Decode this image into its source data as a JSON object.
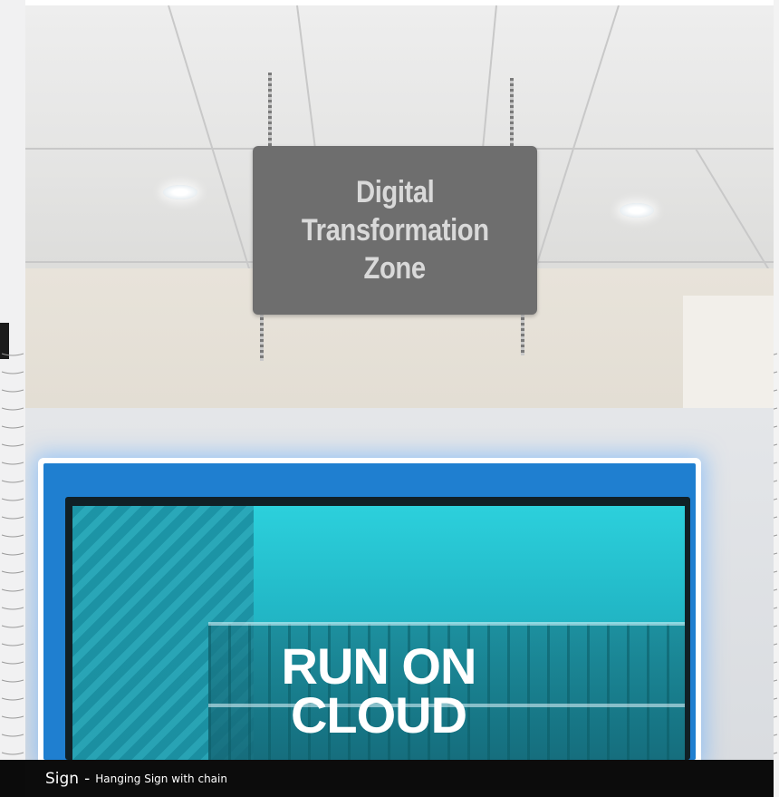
{
  "photo": {
    "sign": {
      "lines": [
        "Digital",
        "Transformation",
        "Zone"
      ]
    },
    "screen": {
      "lines": [
        "RUN ON",
        "CLOUD"
      ]
    }
  },
  "caption": {
    "title": "Sign",
    "separator": "-",
    "description": "Hanging Sign with chain"
  },
  "colors": {
    "sign_plate": "#6e6e6e",
    "sign_text": "#d9d9d9",
    "screen_tint": "#22b8c7",
    "screen_glow": "#1f7fd0",
    "caption_bar": "#0c0c0c"
  }
}
